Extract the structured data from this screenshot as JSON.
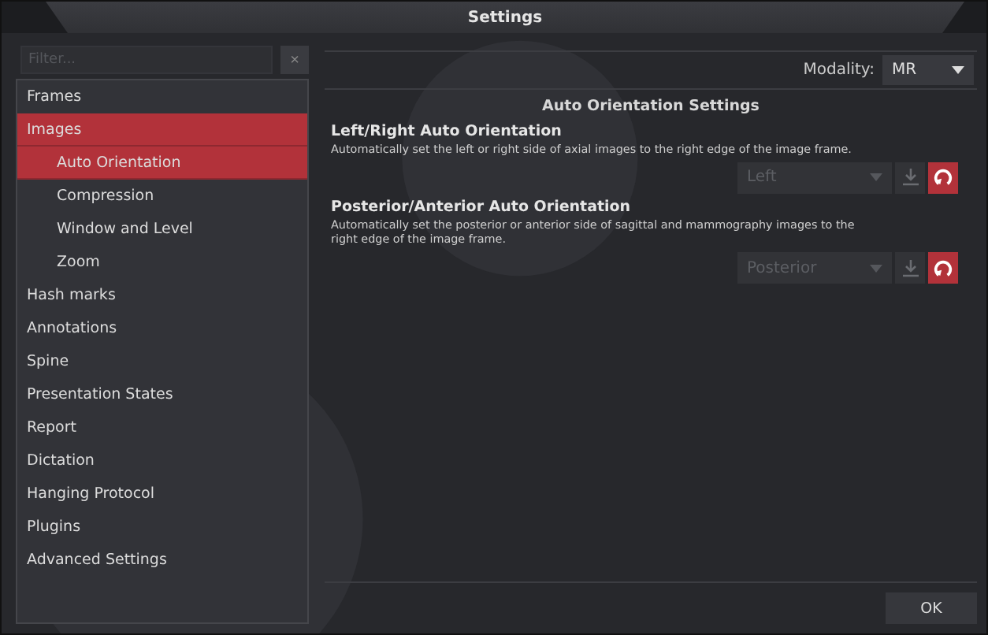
{
  "window": {
    "title": "Settings"
  },
  "filter": {
    "placeholder": "Filter...",
    "clear": "×"
  },
  "sidebar": {
    "items": [
      {
        "label": "Frames",
        "selected": false
      },
      {
        "label": "Images",
        "selected": true,
        "children": [
          {
            "label": "Auto Orientation",
            "selected": true
          },
          {
            "label": "Compression",
            "selected": false
          },
          {
            "label": "Window and Level",
            "selected": false
          },
          {
            "label": "Zoom",
            "selected": false
          }
        ]
      },
      {
        "label": "Hash marks",
        "selected": false
      },
      {
        "label": "Annotations",
        "selected": false
      },
      {
        "label": "Spine",
        "selected": false
      },
      {
        "label": "Presentation States",
        "selected": false
      },
      {
        "label": "Report",
        "selected": false
      },
      {
        "label": "Dictation",
        "selected": false
      },
      {
        "label": "Hanging Protocol",
        "selected": false
      },
      {
        "label": "Plugins",
        "selected": false
      },
      {
        "label": "Advanced Settings",
        "selected": false
      }
    ]
  },
  "modality": {
    "label": "Modality:",
    "value": "MR"
  },
  "section_title": "Auto Orientation Settings",
  "settings": [
    {
      "title": "Left/Right Auto Orientation",
      "description": "Automatically set the left or right side of axial images to the right edge of the image frame.",
      "value": "Left",
      "disabled": true
    },
    {
      "title": "Posterior/Anterior Auto Orientation",
      "description": "Automatically set the posterior or anterior side of sagittal and mammography images to the right edge of the image frame.",
      "value": "Posterior",
      "disabled": true
    }
  ],
  "buttons": {
    "ok": "OK"
  }
}
